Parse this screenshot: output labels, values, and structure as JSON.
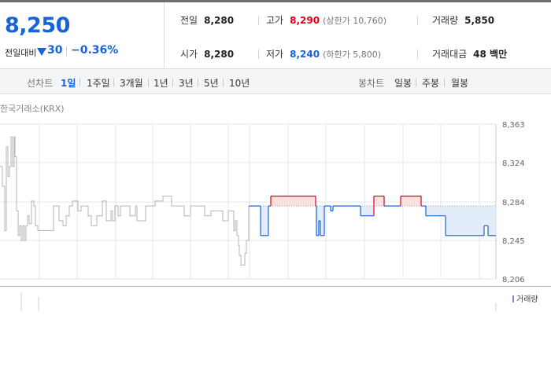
{
  "quote": {
    "current_price": "8,250",
    "change_label": "전일대비",
    "change_amount": "30",
    "change_percent": "−0.36%",
    "prev_close_label": "전일",
    "prev_close": "8,280",
    "open_label": "시가",
    "open": "8,280",
    "high_label": "고가",
    "high": "8,290",
    "upper_limit": "(상한가 10,760)",
    "low_label": "저가",
    "low": "8,240",
    "lower_limit": "(하한가 5,800)",
    "volume_label": "거래량",
    "volume": "5,850",
    "turnover_label": "거래대금",
    "turnover": "48 백만"
  },
  "period_bar": {
    "line_chart_label": "선차트",
    "line_tabs": [
      "1일",
      "1주일",
      "3개월",
      "1년",
      "3년",
      "5년",
      "10년"
    ],
    "candle_chart_label": "봉차트",
    "candle_tabs": [
      "일봉",
      "주봉",
      "월봉"
    ]
  },
  "chart": {
    "exchange": "한국거래소(KRX)",
    "volume_legend": "거래량"
  },
  "colors": {
    "down": "#1763d9",
    "up": "#e3001b",
    "down_fill": "#e3edfa",
    "up_fill": "#fbe0e2",
    "prev_line": "#b4b4b4",
    "grid": "#e5e5e5"
  },
  "chart_data": {
    "type": "line",
    "ylim": [
      8206,
      8363
    ],
    "yticks": [
      "8,363",
      "8,324",
      "8,284",
      "8,245",
      "8,206"
    ],
    "baseline": 8280,
    "previous_session_points": [
      [
        0,
        8320
      ],
      [
        3,
        8320
      ],
      [
        3,
        8300
      ],
      [
        6,
        8300
      ],
      [
        6,
        8255
      ],
      [
        8,
        8255
      ],
      [
        8,
        8340
      ],
      [
        10,
        8340
      ],
      [
        10,
        8310
      ],
      [
        12,
        8310
      ],
      [
        12,
        8320
      ],
      [
        14,
        8320
      ],
      [
        14,
        8350
      ],
      [
        16,
        8350
      ],
      [
        16,
        8320
      ],
      [
        18,
        8320
      ],
      [
        18,
        8350
      ],
      [
        19,
        8350
      ],
      [
        19,
        8330
      ],
      [
        21,
        8330
      ],
      [
        21,
        8275
      ],
      [
        23,
        8275
      ],
      [
        23,
        8250
      ],
      [
        25,
        8250
      ],
      [
        25,
        8260
      ],
      [
        27,
        8260
      ],
      [
        27,
        8245
      ],
      [
        29,
        8245
      ],
      [
        29,
        8260
      ],
      [
        31,
        8260
      ],
      [
        31,
        8245
      ],
      [
        33,
        8245
      ],
      [
        33,
        8260
      ],
      [
        35,
        8260
      ],
      [
        35,
        8270
      ],
      [
        37,
        8270
      ],
      [
        37,
        8262
      ],
      [
        40,
        8262
      ],
      [
        40,
        8285
      ],
      [
        43,
        8285
      ],
      [
        43,
        8280
      ],
      [
        45,
        8280
      ],
      [
        45,
        8260
      ],
      [
        48,
        8260
      ],
      [
        48,
        8255
      ],
      [
        68,
        8255
      ],
      [
        68,
        8280
      ],
      [
        75,
        8280
      ],
      [
        75,
        8265
      ],
      [
        80,
        8265
      ],
      [
        80,
        8260
      ],
      [
        84,
        8260
      ],
      [
        84,
        8270
      ],
      [
        88,
        8270
      ],
      [
        88,
        8280
      ],
      [
        92,
        8280
      ],
      [
        92,
        8285
      ],
      [
        99,
        8285
      ],
      [
        99,
        8275
      ],
      [
        103,
        8275
      ],
      [
        103,
        8280
      ],
      [
        112,
        8280
      ],
      [
        112,
        8270
      ],
      [
        116,
        8270
      ],
      [
        116,
        8260
      ],
      [
        123,
        8260
      ],
      [
        123,
        8270
      ],
      [
        130,
        8270
      ],
      [
        130,
        8285
      ],
      [
        135,
        8285
      ],
      [
        135,
        8265
      ],
      [
        141,
        8265
      ],
      [
        141,
        8275
      ],
      [
        143,
        8275
      ],
      [
        143,
        8265
      ],
      [
        146,
        8265
      ],
      [
        146,
        8280
      ],
      [
        150,
        8280
      ],
      [
        150,
        8270
      ],
      [
        153,
        8270
      ],
      [
        153,
        8280
      ],
      [
        165,
        8280
      ],
      [
        165,
        8270
      ],
      [
        172,
        8270
      ],
      [
        172,
        8280
      ],
      [
        174,
        8280
      ],
      [
        174,
        8265
      ],
      [
        185,
        8265
      ],
      [
        185,
        8280
      ],
      [
        197,
        8280
      ],
      [
        197,
        8285
      ],
      [
        207,
        8285
      ],
      [
        207,
        8290
      ],
      [
        218,
        8290
      ],
      [
        218,
        8280
      ],
      [
        234,
        8280
      ],
      [
        234,
        8270
      ],
      [
        242,
        8270
      ],
      [
        242,
        8280
      ],
      [
        260,
        8280
      ],
      [
        260,
        8270
      ],
      [
        268,
        8270
      ],
      [
        268,
        8275
      ],
      [
        283,
        8275
      ],
      [
        283,
        8265
      ],
      [
        290,
        8265
      ],
      [
        290,
        8275
      ],
      [
        297,
        8275
      ],
      [
        297,
        8255
      ],
      [
        299,
        8255
      ],
      [
        299,
        8265
      ],
      [
        301,
        8265
      ],
      [
        301,
        8250
      ],
      [
        303,
        8250
      ],
      [
        303,
        8240
      ],
      [
        304,
        8240
      ],
      [
        304,
        8230
      ],
      [
        306,
        8230
      ],
      [
        306,
        8220
      ],
      [
        311,
        8220
      ],
      [
        311,
        8232
      ],
      [
        313,
        8232
      ],
      [
        313,
        8245
      ],
      [
        316,
        8245
      ],
      [
        316,
        8280
      ]
    ],
    "session_points": [
      [
        316,
        8280
      ],
      [
        331,
        8280
      ],
      [
        331,
        8250
      ],
      [
        341,
        8250
      ],
      [
        341,
        8280
      ],
      [
        344,
        8280
      ],
      [
        344,
        8290
      ],
      [
        401,
        8290
      ],
      [
        401,
        8280
      ],
      [
        402,
        8280
      ],
      [
        402,
        8250
      ],
      [
        405,
        8250
      ],
      [
        405,
        8265
      ],
      [
        407,
        8265
      ],
      [
        407,
        8250
      ],
      [
        412,
        8250
      ],
      [
        412,
        8280
      ],
      [
        420,
        8280
      ],
      [
        420,
        8275
      ],
      [
        423,
        8275
      ],
      [
        423,
        8280
      ],
      [
        458,
        8280
      ],
      [
        458,
        8270
      ],
      [
        475,
        8270
      ],
      [
        475,
        8290
      ],
      [
        488,
        8290
      ],
      [
        488,
        8280
      ],
      [
        509,
        8280
      ],
      [
        509,
        8290
      ],
      [
        535,
        8290
      ],
      [
        535,
        8280
      ],
      [
        541,
        8280
      ],
      [
        541,
        8270
      ],
      [
        566,
        8270
      ],
      [
        566,
        8250
      ],
      [
        615,
        8250
      ],
      [
        615,
        8260
      ],
      [
        620,
        8260
      ],
      [
        620,
        8250
      ],
      [
        630,
        8250
      ]
    ]
  }
}
